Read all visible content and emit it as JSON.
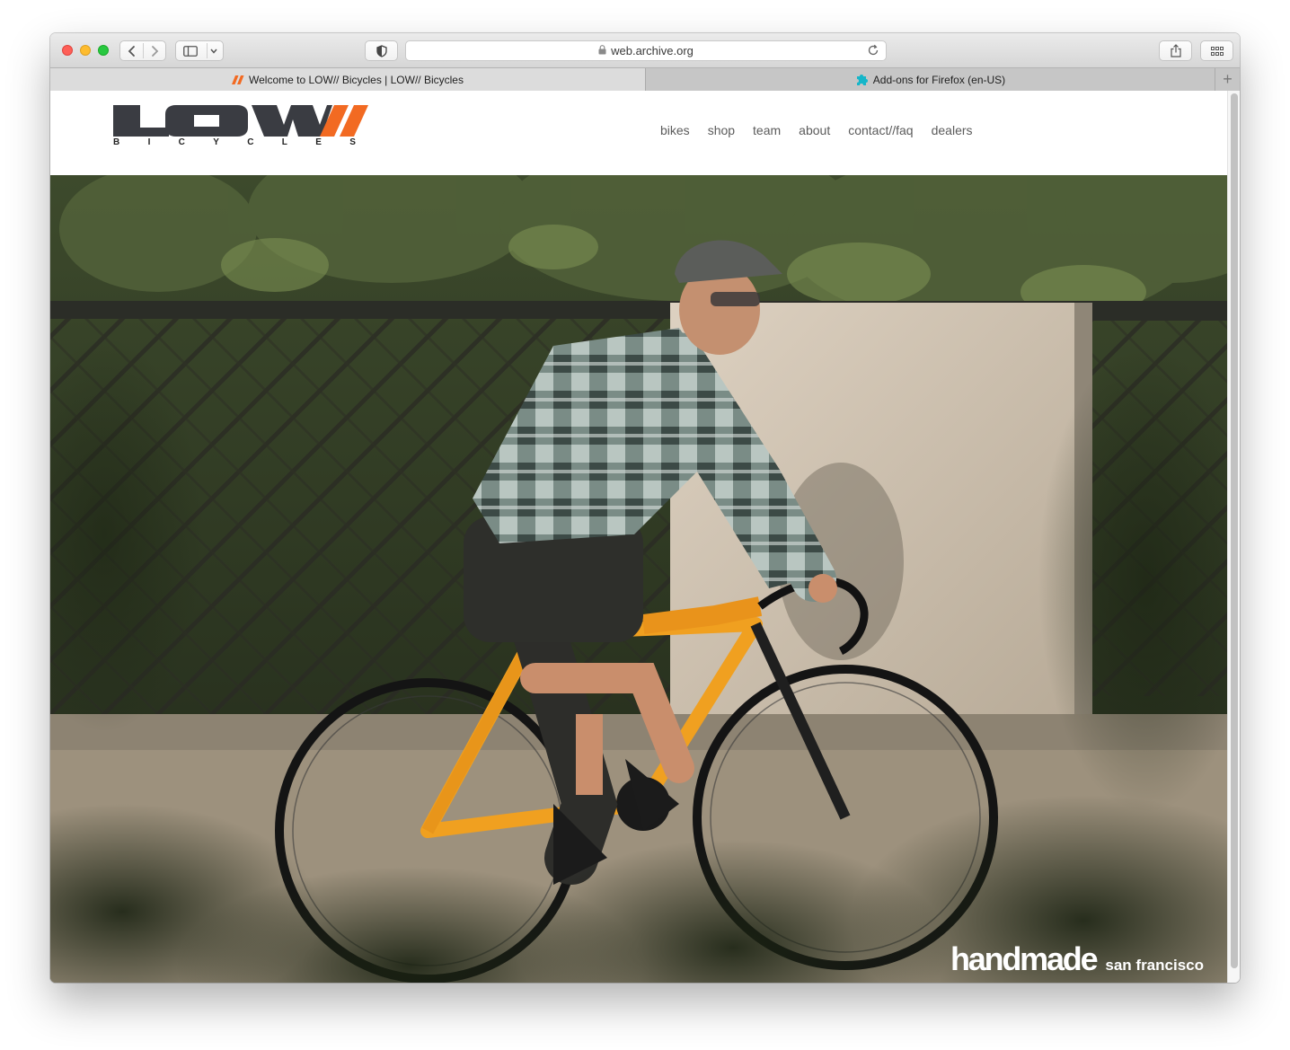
{
  "browser": {
    "address": "web.archive.org",
    "tabs": [
      {
        "label": "Welcome to LOW// Bicycles | LOW// Bicycles",
        "active": true
      },
      {
        "label": "Add-ons for Firefox (en-US)",
        "active": false
      }
    ],
    "new_tab_label": "+"
  },
  "site": {
    "logo_text": "LOW",
    "logo_slashes": "//",
    "logo_sub": [
      "B",
      "I",
      "C",
      "Y",
      "C",
      "L",
      "E",
      "S"
    ],
    "nav": [
      "bikes",
      "shop",
      "team",
      "about",
      "contact//faq",
      "dealers"
    ],
    "hero": {
      "tagline_main": "handmade",
      "tagline_sub": "san francisco"
    }
  },
  "colors": {
    "brand_orange": "#f26a22",
    "logo_dark": "#3a3c42",
    "frame_orange": "#f0a020"
  },
  "icons": [
    "back-icon",
    "forward-icon",
    "sidebar-icon",
    "chevron-down-icon",
    "privacy-shield-icon",
    "lock-icon",
    "reload-icon",
    "share-icon",
    "tab-overview-icon"
  ]
}
